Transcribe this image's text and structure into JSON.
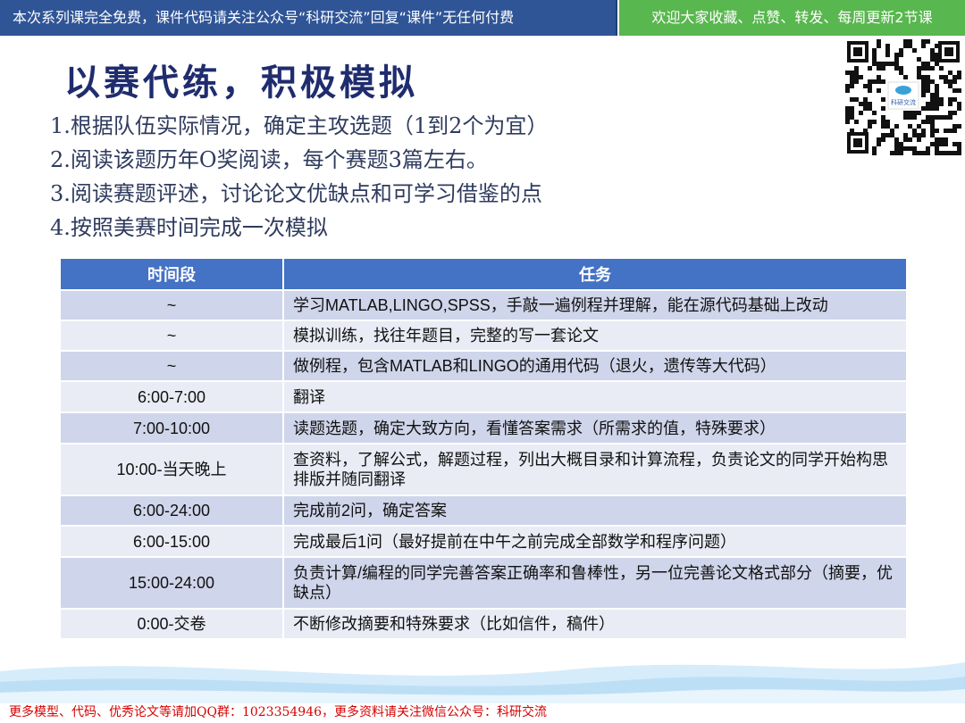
{
  "banner": {
    "left_text": "本次系列课完全免费，课件代码请关注公众号“科研交流”回复“课件”无任何付费",
    "right_text": "欢迎大家收藏、点赞、转发、每周更新2节课",
    "left_color": "#2f5597",
    "right_color": "#58b74e"
  },
  "title": "以赛代练，积极模拟",
  "steps": [
    "1.根据队伍实际情况，确定主攻选题（1到2个为宜）",
    "2.阅读该题历年O奖阅读，每个赛题3篇左右。",
    "3.阅读赛题评述，讨论论文优缺点和可学习借鉴的点",
    "4.按照美赛时间完成一次模拟"
  ],
  "table": {
    "headers": [
      "时间段",
      "任务"
    ],
    "rows": [
      {
        "time": "~",
        "task": "学习MATLAB,LINGO,SPSS，手敲一遍例程并理解，能在源代码基础上改动"
      },
      {
        "time": "~",
        "task": "模拟训练，找往年题目，完整的写一套论文"
      },
      {
        "time": "~",
        "task": "做例程，包含MATLAB和LINGO的通用代码（退火，遗传等大代码）"
      },
      {
        "time": "6:00-7:00",
        "task": "翻译"
      },
      {
        "time": "7:00-10:00",
        "task": "读题选题，确定大致方向，看懂答案需求（所需求的值，特殊要求）"
      },
      {
        "time": "10:00-当天晚上",
        "task": "查资料，了解公式，解题过程，列出大概目录和计算流程，负责论文的同学开始构思排版并随同翻译"
      },
      {
        "time": "6:00-24:00",
        "task": "完成前2问，确定答案"
      },
      {
        "time": "6:00-15:00",
        "task": "完成最后1问（最好提前在中午之前完成全部数学和程序问题）"
      },
      {
        "time": "15:00-24:00",
        "task": "负责计算/编程的同学完善答案正确率和鲁棒性，另一位完善论文格式部分（摘要，优缺点）"
      },
      {
        "time": "0:00-交卷",
        "task": "不断修改摘要和特殊要求（比如信件，稿件）"
      }
    ]
  },
  "qr_logo_text": "科研交流",
  "footer": "更多模型、代码、优秀论文等请加QQ群：1023354946，更多资料请关注微信公众号：科研交流"
}
